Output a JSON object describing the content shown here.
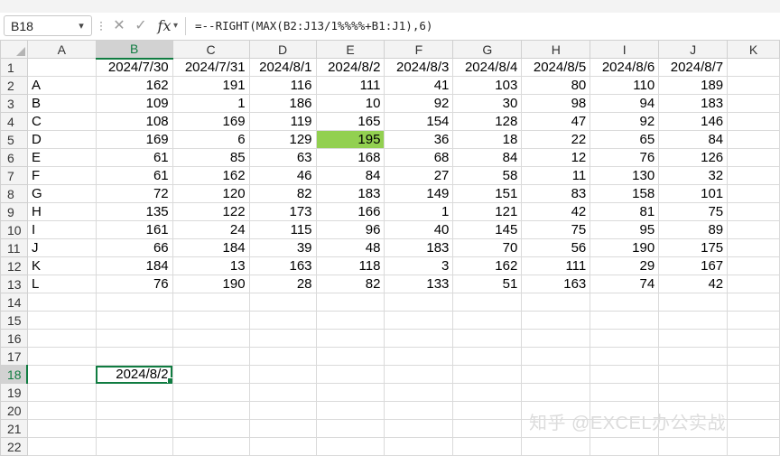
{
  "formula_bar": {
    "name_box": "B18",
    "cancel_icon": "✕",
    "enter_icon": "✓",
    "fx_label": "fx",
    "formula": "=--RIGHT(MAX(B2:J13/1%%%%+B1:J1),6)"
  },
  "columns": [
    "A",
    "B",
    "C",
    "D",
    "E",
    "F",
    "G",
    "H",
    "I",
    "J",
    "K"
  ],
  "rows": [
    {
      "n": "1",
      "cells": [
        "",
        "2024/7/30",
        "2024/7/31",
        "2024/8/1",
        "2024/8/2",
        "2024/8/3",
        "2024/8/4",
        "2024/8/5",
        "2024/8/6",
        "2024/8/7",
        ""
      ]
    },
    {
      "n": "2",
      "cells": [
        "A",
        "162",
        "191",
        "116",
        "111",
        "41",
        "103",
        "80",
        "110",
        "189",
        ""
      ]
    },
    {
      "n": "3",
      "cells": [
        "B",
        "109",
        "1",
        "186",
        "10",
        "92",
        "30",
        "98",
        "94",
        "183",
        ""
      ]
    },
    {
      "n": "4",
      "cells": [
        "C",
        "108",
        "169",
        "119",
        "165",
        "154",
        "128",
        "47",
        "92",
        "146",
        ""
      ]
    },
    {
      "n": "5",
      "cells": [
        "D",
        "169",
        "6",
        "129",
        "195",
        "36",
        "18",
        "22",
        "65",
        "84",
        ""
      ]
    },
    {
      "n": "6",
      "cells": [
        "E",
        "61",
        "85",
        "63",
        "168",
        "68",
        "84",
        "12",
        "76",
        "126",
        ""
      ]
    },
    {
      "n": "7",
      "cells": [
        "F",
        "61",
        "162",
        "46",
        "84",
        "27",
        "58",
        "11",
        "130",
        "32",
        ""
      ]
    },
    {
      "n": "8",
      "cells": [
        "G",
        "72",
        "120",
        "82",
        "183",
        "149",
        "151",
        "83",
        "158",
        "101",
        ""
      ]
    },
    {
      "n": "9",
      "cells": [
        "H",
        "135",
        "122",
        "173",
        "166",
        "1",
        "121",
        "42",
        "81",
        "75",
        ""
      ]
    },
    {
      "n": "10",
      "cells": [
        "I",
        "161",
        "24",
        "115",
        "96",
        "40",
        "145",
        "75",
        "95",
        "89",
        ""
      ]
    },
    {
      "n": "11",
      "cells": [
        "J",
        "66",
        "184",
        "39",
        "48",
        "183",
        "70",
        "56",
        "190",
        "175",
        ""
      ]
    },
    {
      "n": "12",
      "cells": [
        "K",
        "184",
        "13",
        "163",
        "118",
        "3",
        "162",
        "111",
        "29",
        "167",
        ""
      ]
    },
    {
      "n": "13",
      "cells": [
        "L",
        "76",
        "190",
        "28",
        "82",
        "133",
        "51",
        "163",
        "74",
        "42",
        ""
      ]
    },
    {
      "n": "14",
      "cells": [
        "",
        "",
        "",
        "",
        "",
        "",
        "",
        "",
        "",
        "",
        ""
      ]
    },
    {
      "n": "15",
      "cells": [
        "",
        "",
        "",
        "",
        "",
        "",
        "",
        "",
        "",
        "",
        ""
      ]
    },
    {
      "n": "16",
      "cells": [
        "",
        "",
        "",
        "",
        "",
        "",
        "",
        "",
        "",
        "",
        ""
      ]
    },
    {
      "n": "17",
      "cells": [
        "",
        "",
        "",
        "",
        "",
        "",
        "",
        "",
        "",
        "",
        ""
      ]
    },
    {
      "n": "18",
      "cells": [
        "",
        "2024/8/2",
        "",
        "",
        "",
        "",
        "",
        "",
        "",
        "",
        ""
      ]
    },
    {
      "n": "19",
      "cells": [
        "",
        "",
        "",
        "",
        "",
        "",
        "",
        "",
        "",
        "",
        ""
      ]
    },
    {
      "n": "20",
      "cells": [
        "",
        "",
        "",
        "",
        "",
        "",
        "",
        "",
        "",
        "",
        ""
      ]
    },
    {
      "n": "21",
      "cells": [
        "",
        "",
        "",
        "",
        "",
        "",
        "",
        "",
        "",
        "",
        ""
      ]
    },
    {
      "n": "22",
      "cells": [
        "",
        "",
        "",
        "",
        "",
        "",
        "",
        "",
        "",
        "",
        ""
      ]
    }
  ],
  "selection": {
    "col": "B",
    "row": "18"
  },
  "highlight": {
    "col": "E",
    "row": "5",
    "color": "#92d050"
  },
  "accent_color": "#107c41",
  "watermark": "知乎 @EXCEL办公实战"
}
